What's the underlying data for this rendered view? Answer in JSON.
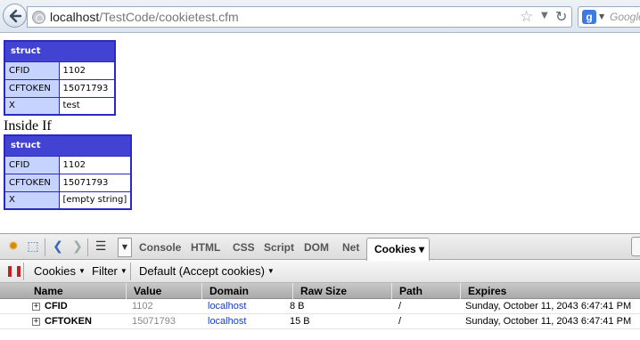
{
  "browser": {
    "url_host": "localhost",
    "url_path": "/TestCode/cookietest.cfm",
    "search_placeholder": "Google"
  },
  "dump1": {
    "header": "struct",
    "rows": [
      {
        "key": "CFID",
        "value": "1102"
      },
      {
        "key": "CFTOKEN",
        "value": "15071793"
      },
      {
        "key": "X",
        "value": "test"
      }
    ]
  },
  "inside_if": "Inside If",
  "dump2": {
    "header": "struct",
    "rows": [
      {
        "key": "CFID",
        "value": "1102"
      },
      {
        "key": "CFTOKEN",
        "value": "15071793"
      },
      {
        "key": "X",
        "value": "[empty string]"
      }
    ]
  },
  "firebug": {
    "tabs": [
      "Console",
      "HTML",
      "CSS",
      "Script",
      "DOM",
      "Net"
    ],
    "active_tab": "Cookies ▾",
    "toolbar": {
      "cookies_menu": "Cookies",
      "filter_menu": "Filter",
      "default_menu": "Default (Accept cookies)"
    },
    "columns": [
      "Name",
      "Value",
      "Domain",
      "Raw Size",
      "Path",
      "Expires"
    ],
    "rows": [
      {
        "name": "CFID",
        "value": "1102",
        "domain": "localhost",
        "raw_size": "8 B",
        "path": "/",
        "expires": "Sunday, October 11, 2043 6:47:41 PM"
      },
      {
        "name": "CFTOKEN",
        "value": "15071793",
        "domain": "localhost",
        "raw_size": "15 B",
        "path": "/",
        "expires": "Sunday, October 11, 2043 6:47:41 PM"
      }
    ]
  },
  "colors": {
    "dump_border": "#2a2ac3",
    "dump_header": "#4343d3",
    "dump_key_bg": "#c6d3ff",
    "domain_link": "#1a3fb7"
  }
}
